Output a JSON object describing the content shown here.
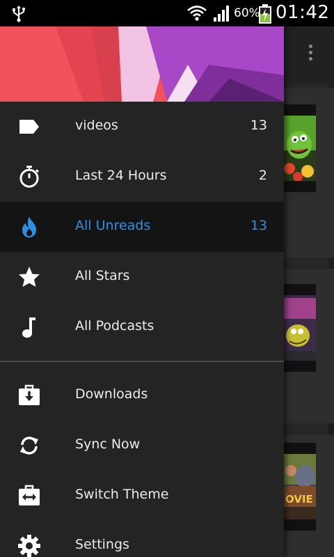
{
  "status_bar": {
    "battery_percent": "60%",
    "time": "01:42",
    "icons": [
      "usb-icon",
      "wifi-icon",
      "signal-icon",
      "battery-charging-icon"
    ]
  },
  "background_app": {
    "toolbar_icon": "overflow-menu-icon"
  },
  "drawer": {
    "primary_items": [
      {
        "label": "videos",
        "count": "13",
        "icon": "tag-icon",
        "selected": false
      },
      {
        "label": "Last 24 Hours",
        "count": "2",
        "icon": "stopwatch-icon",
        "selected": false
      },
      {
        "label": "All Unreads",
        "count": "13",
        "icon": "flame-icon",
        "selected": true
      },
      {
        "label": "All Stars",
        "count": "",
        "icon": "star-icon",
        "selected": false
      },
      {
        "label": "All Podcasts",
        "count": "",
        "icon": "music-note-icon",
        "selected": false
      }
    ],
    "secondary_items": [
      {
        "label": "Downloads",
        "icon": "download-briefcase-icon"
      },
      {
        "label": "Sync Now",
        "icon": "sync-icon"
      },
      {
        "label": "Switch Theme",
        "icon": "switch-theme-icon"
      },
      {
        "label": "Settings",
        "icon": "gear-icon"
      }
    ]
  },
  "colors": {
    "accent": "#2f8fe0",
    "drawer_bg": "#242424",
    "selected_bg": "#141414",
    "header_red": "#f0535c",
    "header_purple": "#a947c9"
  }
}
